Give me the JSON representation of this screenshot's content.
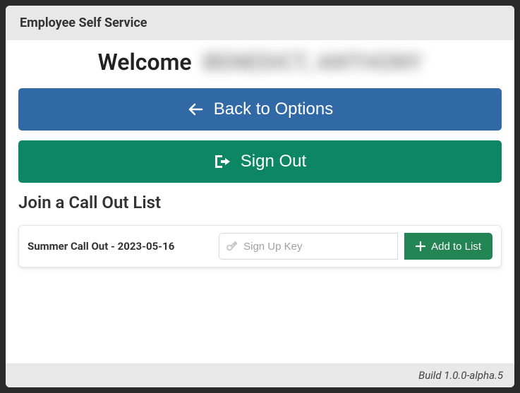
{
  "app": {
    "title": "Employee Self Service"
  },
  "welcome": {
    "prefix": "Welcome",
    "name": "BENEDICT, ANTHONY"
  },
  "buttons": {
    "back": "Back to Options",
    "signout": "Sign Out"
  },
  "section": {
    "heading": "Join a Call Out List"
  },
  "callout": {
    "title": "Summer Call Out - 2023-05-16",
    "placeholder": "Sign Up Key",
    "value": "",
    "add_label": "Add to List"
  },
  "footer": {
    "build": "Build 1.0.0-alpha.5"
  }
}
